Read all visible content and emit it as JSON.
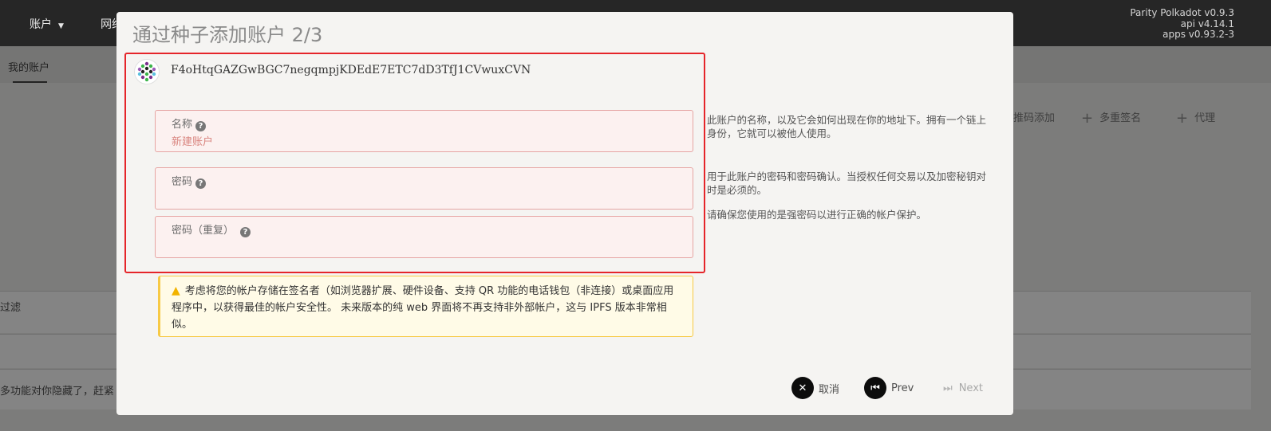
{
  "topbar": {
    "nav": [
      "账户",
      "网络"
    ],
    "version": {
      "line1": "Parity Polkadot v0.9.3",
      "line2": "api v4.14.1",
      "line3": "apps v0.93.2-3"
    }
  },
  "subnav": {
    "active_tab": "我的账户"
  },
  "background_actions": [
    "推码添加",
    "多重签名",
    "代理"
  ],
  "background_rows": {
    "filter_label": "过滤",
    "notice": "多功能对你隐藏了，赶紧"
  },
  "modal": {
    "title": "通过种子添加账户 2/3",
    "address": "F4oHtqGAZGwBGC7negqmpjKDEdE7ETC7dD3TfJ1CVwuxCVN",
    "fields": {
      "name": {
        "label": "名称",
        "value": "新建账户"
      },
      "password": {
        "label": "密码",
        "value": ""
      },
      "password_repeat": {
        "label": "密码（重复）",
        "value": ""
      }
    },
    "hints": {
      "name": "此账户的名称，以及它会如何出现在你的地址下。拥有一个链上身份，它就可以被他人使用。",
      "password": "用于此账户的密码和密码确认。当授权任何交易以及加密秘钥对时是必须的。",
      "password_strength": "请确保您使用的是强密码以进行正确的帐户保护。"
    },
    "warning": "考虑将您的帐户存储在签名者（如浏览器扩展、硬件设备、支持 QR 功能的电话钱包（非连接）或桌面应用程序中，以获得最佳的帐户安全性。 未来版本的纯 web 界面将不再支持非外部帐户，这与 IPFS 版本非常相似。",
    "buttons": {
      "cancel": "取消",
      "prev": "Prev",
      "next": "Next"
    }
  },
  "colors": {
    "highlight": "#e5252a",
    "warning_border": "#f7c945",
    "field_border": "#e6a5a3"
  },
  "icons": [
    "identicon",
    "help-icon",
    "warning-icon",
    "close-icon",
    "prev-icon",
    "next-icon",
    "plus-icon",
    "caret-down-icon"
  ]
}
